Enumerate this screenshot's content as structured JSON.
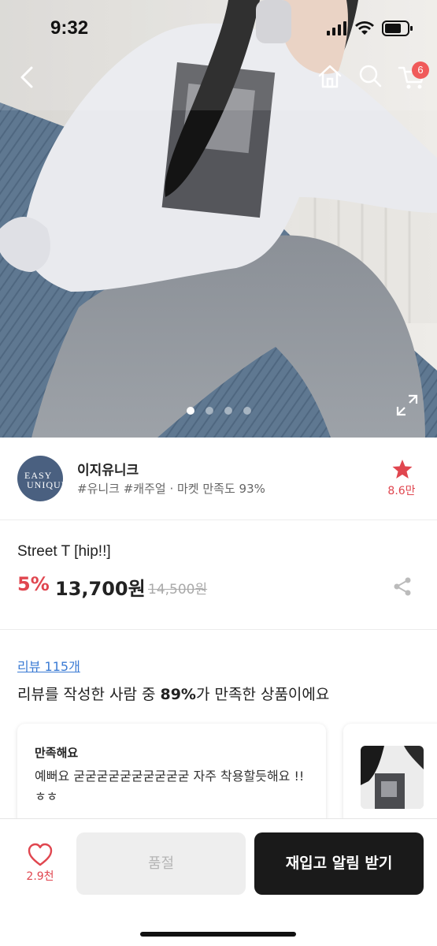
{
  "status_bar": {
    "time": "9:32"
  },
  "nav": {
    "cart_badge": "6"
  },
  "hero": {
    "image_index": 1,
    "image_total": 4
  },
  "seller": {
    "logo_text_line1": "EASY",
    "logo_text_line2": "UNIQUE",
    "name": "이지유니크",
    "tags": "#유니크 #캐주얼 · 마켓 만족도 93%",
    "favorites": "8.6만"
  },
  "product": {
    "title": "Street T [hip!!]",
    "discount": "5%",
    "price": "13,700원",
    "original_price": "14,500원"
  },
  "reviews": {
    "link_label": "리뷰 115개",
    "summary_before": "리뷰를 작성한 사람 중 ",
    "summary_percent": "89%",
    "summary_after": "가 만족한 상품이에요",
    "cards": [
      {
        "heading": "만족해요",
        "text": "예뻐요 굳굳굳굳굳굳굳굳굳굳 자주 착용할듯해요 !! ㅎㅎ"
      }
    ]
  },
  "bottom_bar": {
    "likes": "2.9천",
    "soldout_label": "품절",
    "restock_label": "재입고 알림 받기"
  },
  "colors": {
    "accent": "#e0464f",
    "dark_button": "#1a1a1a",
    "link": "#3b7bd4"
  },
  "icons": [
    "back-icon",
    "home-icon",
    "search-icon",
    "cart-icon",
    "expand-icon",
    "star-icon",
    "share-icon",
    "heart-icon"
  ]
}
